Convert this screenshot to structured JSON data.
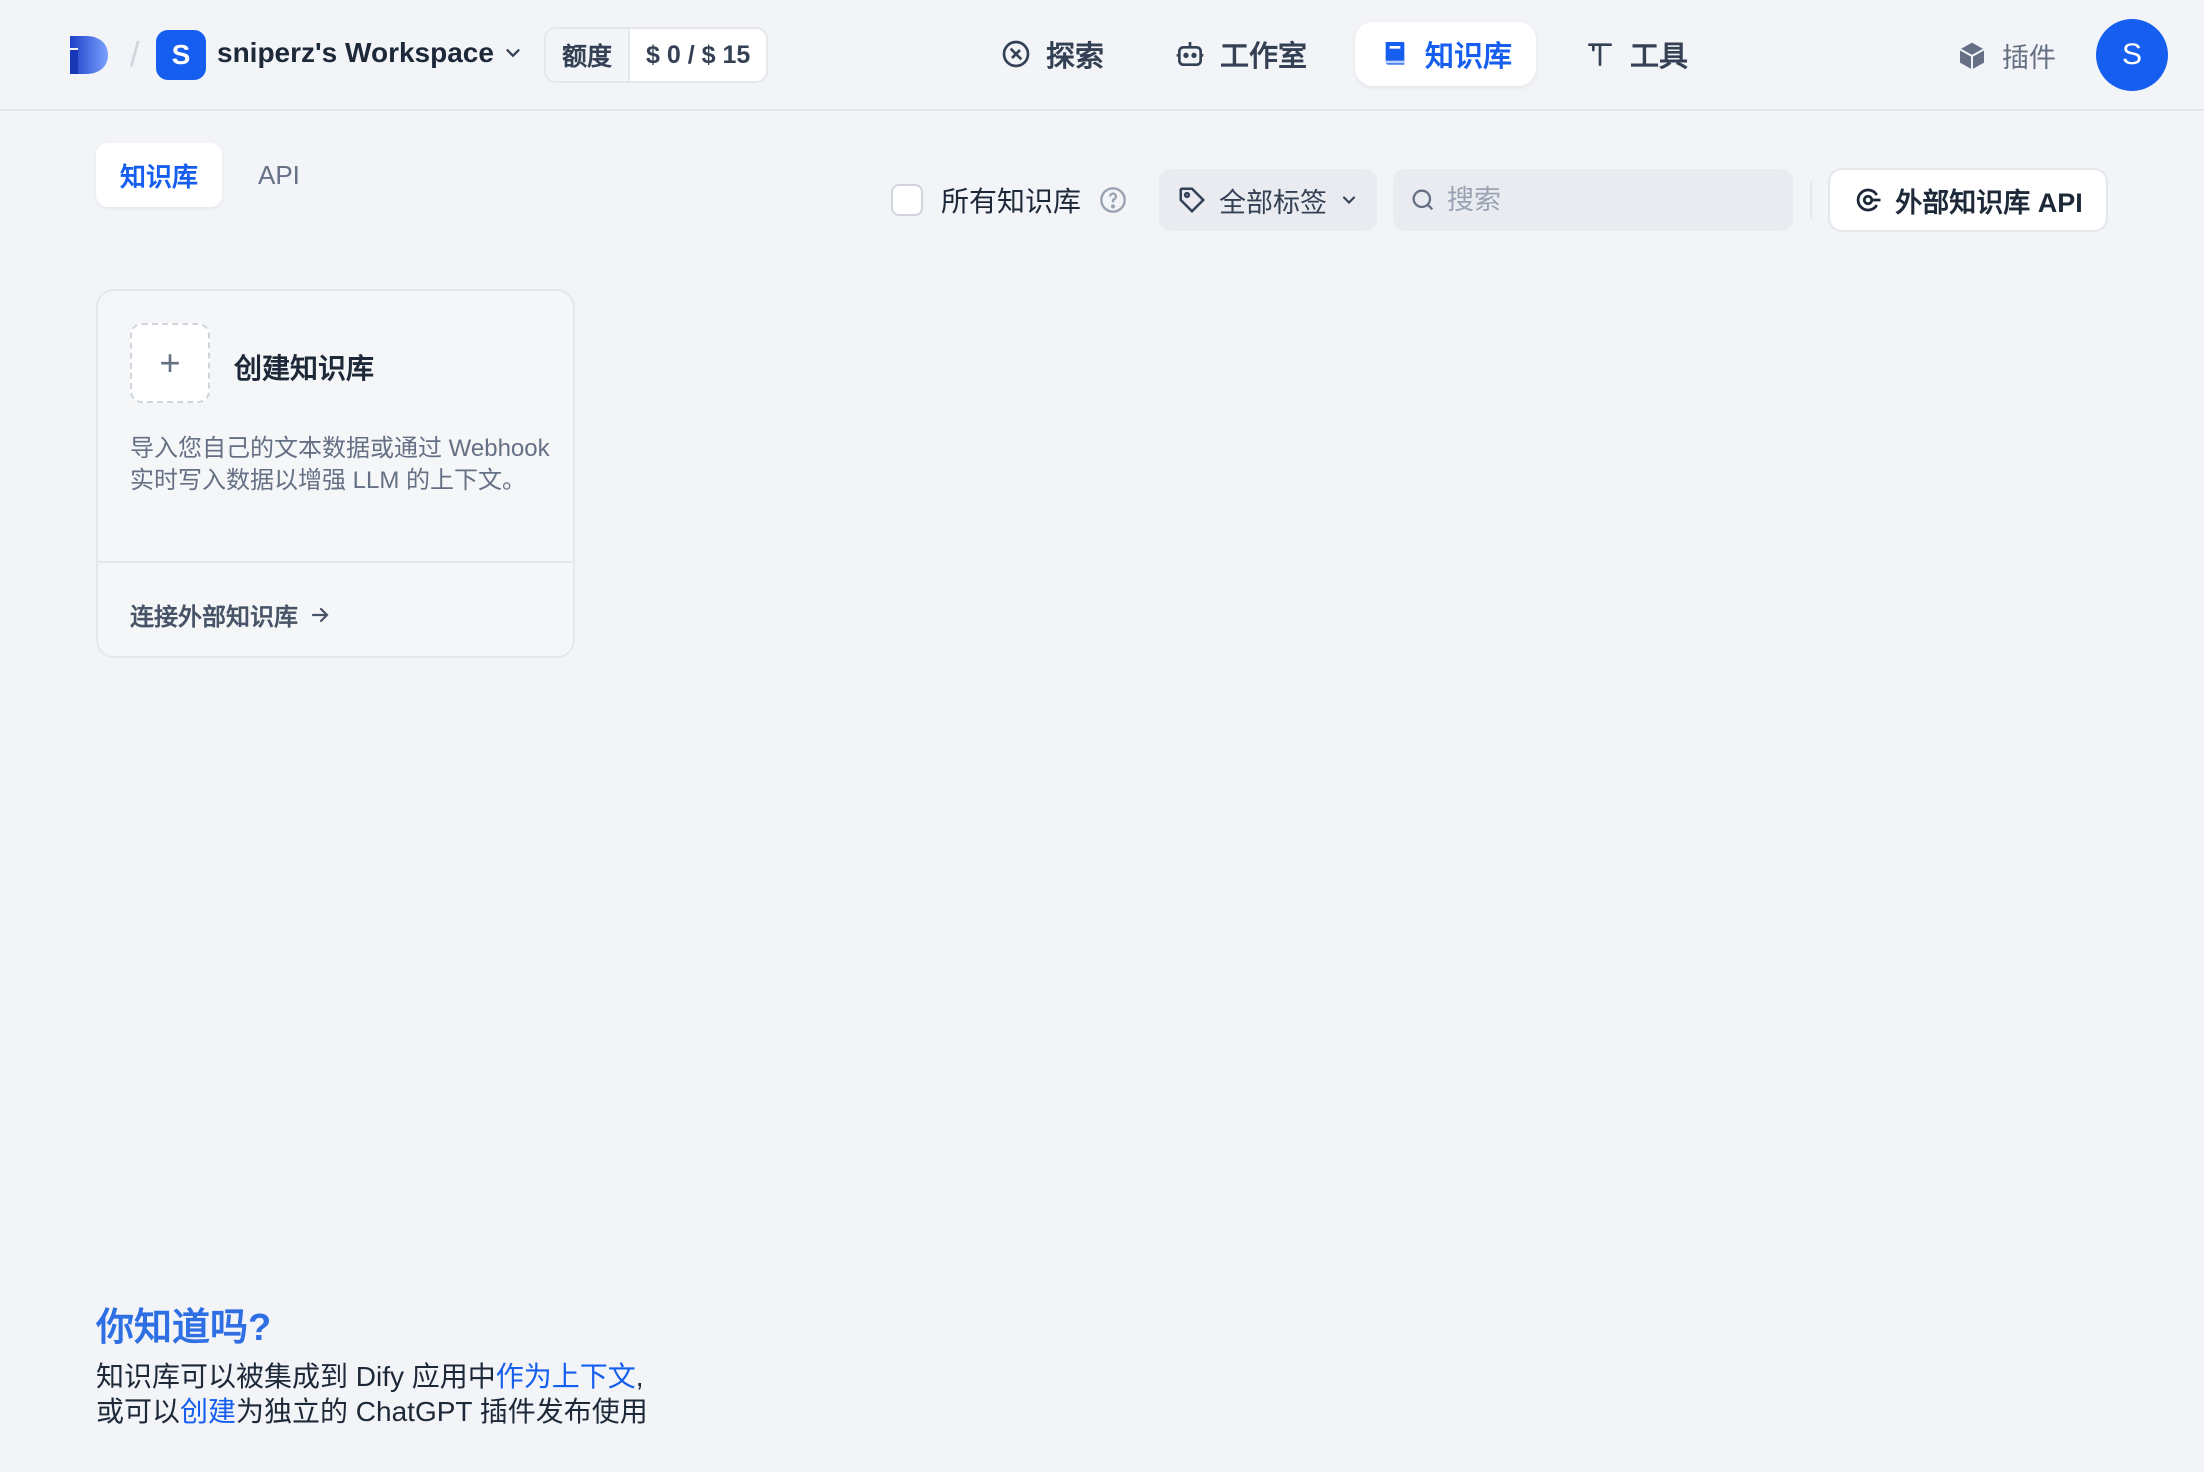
{
  "header": {
    "workspace_initial": "S",
    "workspace_name": "sniperz's Workspace",
    "quota_label": "额度",
    "quota_value": "$ 0 / $ 15",
    "nav": {
      "explore": "探索",
      "studio": "工作室",
      "datasets": "知识库",
      "tools": "工具"
    },
    "plugins_label": "插件",
    "user_initial": "S"
  },
  "tabs": {
    "datasets": "知识库",
    "api": "API"
  },
  "toolbar": {
    "all_kb_label": "所有知识库",
    "tag_filter_label": "全部标签",
    "search_placeholder": "搜索",
    "external_api_label": "外部知识库 API"
  },
  "create_card": {
    "title": "创建知识库",
    "description": "导入您自己的文本数据或通过 Webhook 实时写入数据以增强 LLM 的上下文。",
    "link_label": "连接外部知识库"
  },
  "tip": {
    "title": "你知道吗?",
    "line1_prefix": "知识库可以被集成到 Dify 应用中",
    "line1_link": "作为上下文",
    "line1_suffix": ",",
    "line2_prefix": "或可以",
    "line2_link": "创建",
    "line2_suffix": "为独立的 ChatGPT 插件发布使用"
  },
  "colors": {
    "accent": "#155eef",
    "background": "#f2f4f7",
    "tip_title": "#2e6fe4"
  }
}
